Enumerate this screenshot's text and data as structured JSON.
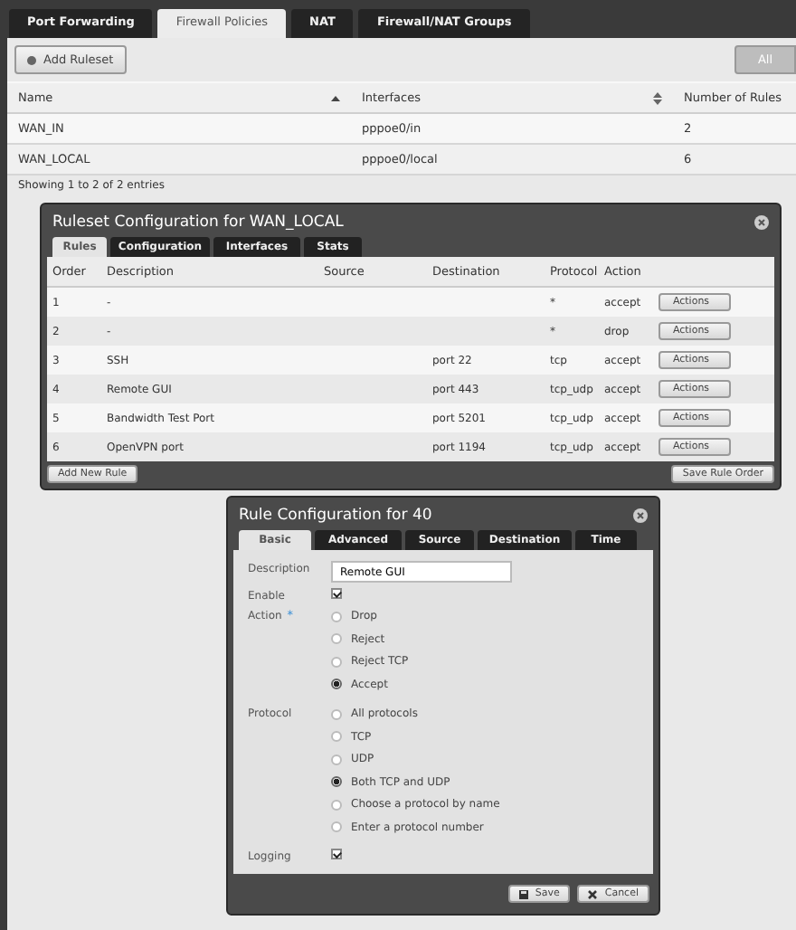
{
  "top_tabs": [
    {
      "label": "Port Forwarding",
      "selected": false
    },
    {
      "label": "Firewall Policies",
      "selected": true
    },
    {
      "label": "NAT",
      "selected": false
    },
    {
      "label": "Firewall/NAT Groups",
      "selected": false
    }
  ],
  "toolbar": {
    "add_button": "Add Ruleset",
    "filter_button": "All"
  },
  "rulesets": {
    "columns": [
      "Name",
      "Interfaces",
      "Number of Rules"
    ],
    "rows": [
      [
        "WAN_IN",
        "pppoe0/in",
        "2"
      ],
      [
        "WAN_LOCAL",
        "pppoe0/local",
        "6"
      ]
    ],
    "info": "Showing 1 to 2 of 2 entries"
  },
  "ruleset_dialog": {
    "title": "Ruleset Configuration for WAN_LOCAL",
    "tabs": [
      {
        "label": "Rules",
        "selected": true
      },
      {
        "label": "Configuration",
        "selected": false
      },
      {
        "label": "Interfaces",
        "selected": false
      },
      {
        "label": "Stats",
        "selected": false
      }
    ],
    "columns": [
      "Order",
      "Description",
      "Source",
      "Destination",
      "Protocol",
      "Action"
    ],
    "rows": [
      {
        "order": "1",
        "description": "-",
        "protocol": "*",
        "action": "accept",
        "menu": "Actions"
      },
      {
        "order": "2",
        "description": "-",
        "protocol": "*",
        "action": "drop",
        "menu": "Actions"
      },
      {
        "order": "3",
        "description": "SSH",
        "destination": "port 22",
        "protocol": "tcp",
        "action": "accept",
        "menu": "Actions"
      },
      {
        "order": "4",
        "description": "Remote GUI",
        "destination": "port 443",
        "protocol": "tcp_udp",
        "action": "accept",
        "menu": "Actions"
      },
      {
        "order": "5",
        "description": "Bandwidth Test Port",
        "destination": "port 5201",
        "protocol": "tcp_udp",
        "action": "accept",
        "menu": "Actions"
      },
      {
        "order": "6",
        "description": "OpenVPN port",
        "destination": "port 1194",
        "protocol": "tcp_udp",
        "action": "accept",
        "menu": "Actions"
      }
    ],
    "add_button": "Add New Rule",
    "save_button": "Save Rule Order"
  },
  "rule_dialog": {
    "title": "Rule Configuration for 40",
    "tabs": [
      {
        "label": "Basic",
        "selected": true
      },
      {
        "label": "Advanced",
        "selected": false
      },
      {
        "label": "Source",
        "selected": false
      },
      {
        "label": "Destination",
        "selected": false
      },
      {
        "label": "Time",
        "selected": false
      }
    ],
    "description_label": "Description",
    "description_value": "Remote GUI",
    "enable_label": "Enable",
    "enable_checked": true,
    "action_label": "Action",
    "required_mark": "*",
    "action_options": [
      {
        "label": "Drop",
        "selected": false
      },
      {
        "label": "Reject",
        "selected": false
      },
      {
        "label": "Reject TCP",
        "selected": false
      },
      {
        "label": "Accept",
        "selected": true
      }
    ],
    "protocol_label": "Protocol",
    "protocol_options": [
      {
        "label": "All protocols",
        "selected": false
      },
      {
        "label": "TCP",
        "selected": false
      },
      {
        "label": "UDP",
        "selected": false
      },
      {
        "label": "Both TCP and UDP",
        "selected": true
      },
      {
        "label": "Choose a protocol by name",
        "selected": false
      },
      {
        "label": "Enter a protocol number",
        "selected": false
      }
    ],
    "logging_label": "Logging",
    "logging_checked": true,
    "save_button": "Save",
    "cancel_button": "Cancel"
  }
}
